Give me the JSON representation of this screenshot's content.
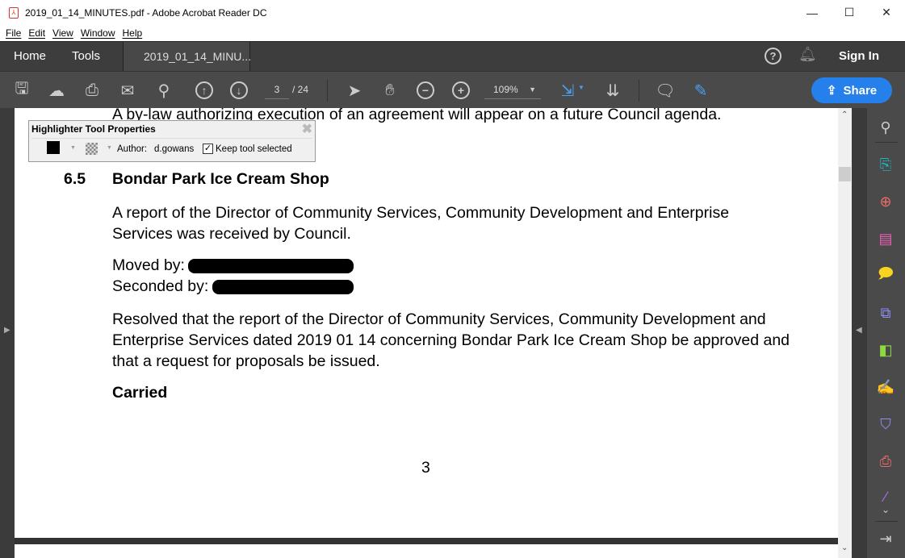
{
  "window": {
    "title": "2019_01_14_MINUTES.pdf - Adobe Acrobat Reader DC"
  },
  "menu": [
    "File",
    "Edit",
    "View",
    "Window",
    "Help"
  ],
  "tabs": {
    "home": "Home",
    "tools": "Tools",
    "document": "2019_01_14_MINU...",
    "close": "×"
  },
  "header": {
    "sign_in": "Sign In"
  },
  "toolbar": {
    "page_current": "3",
    "page_total": "/  24",
    "zoom": "109%",
    "share": "Share"
  },
  "highlighter": {
    "title": "Highlighter Tool Properties",
    "author_label": "Author:",
    "author": "d.gowans",
    "keep_selected": "Keep tool selected",
    "color": "#000000"
  },
  "document": {
    "prev_line": "A by-law authorizing execution of an agreement will appear on a future Council agenda.",
    "section_number": "6.5",
    "section_title": "Bondar Park Ice Cream Shop",
    "para1": "A report of the Director of Community Services, Community Development and Enterprise Services was received by Council.",
    "moved_by": "Moved by:",
    "seconded_by": "Seconded by:",
    "resolution": "Resolved that the report of the Director of Community Services, Community Development and Enterprise Services dated 2019 01 14 concerning Bondar Park Ice Cream Shop be approved and that a request for proposals be issued.",
    "status": "Carried",
    "page_number": "3"
  },
  "colors": {
    "accent": "#2680eb",
    "toolbar": "#4a4a4a",
    "tabbar": "#3d3d3d"
  }
}
